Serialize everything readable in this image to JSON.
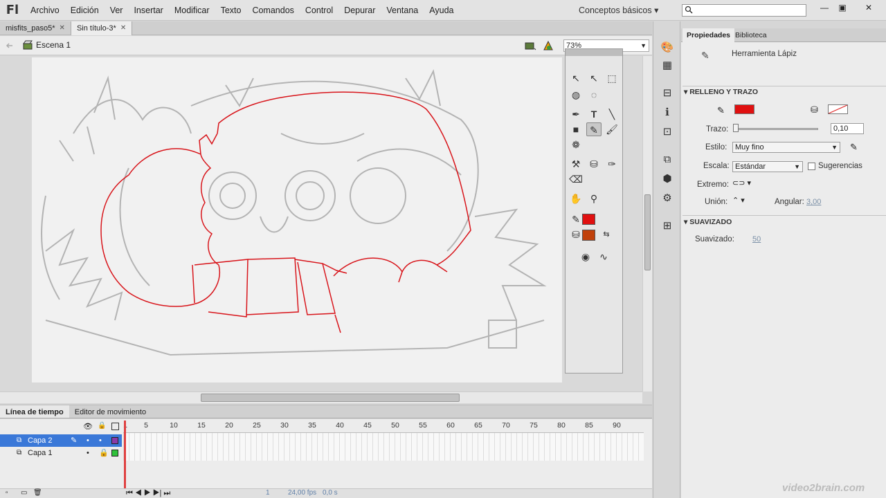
{
  "app": {
    "logo": "Fl",
    "workspace": "Conceptos básicos ▾"
  },
  "menu": [
    "Archivo",
    "Edición",
    "Ver",
    "Insertar",
    "Modificar",
    "Texto",
    "Comandos",
    "Control",
    "Depurar",
    "Ventana",
    "Ayuda"
  ],
  "window_buttons": [
    "—",
    "▣",
    "✕"
  ],
  "doc_tabs": [
    {
      "label": "misfits_paso5*",
      "close": "✕"
    },
    {
      "label": "Sin título-3*",
      "close": "✕"
    }
  ],
  "scene": {
    "label": "Escena 1",
    "zoom": "73%"
  },
  "timeline": {
    "tabs": [
      "Línea de tiempo",
      "Editor de movimiento"
    ],
    "ticks": [
      "1",
      "5",
      "10",
      "15",
      "20",
      "25",
      "30",
      "35",
      "40",
      "45",
      "50",
      "55",
      "60",
      "65",
      "70",
      "75",
      "80",
      "85",
      "90"
    ],
    "layers": [
      {
        "name": "Capa 2",
        "color": "#8a3aa8",
        "selected": true
      },
      {
        "name": "Capa 1",
        "color": "#2fc13a",
        "selected": false
      }
    ],
    "status": {
      "frame": "1",
      "fps": "24,00 fps",
      "time": "0,0 s"
    }
  },
  "properties": {
    "tabs": [
      "Propiedades",
      "Biblioteca"
    ],
    "tool_name": "Herramienta Lápiz",
    "fill_stroke": {
      "title": "RELLENO Y TRAZO",
      "stroke_color": "#e01010",
      "trazo_label": "Trazo:",
      "trazo_value": "0,10",
      "estilo_label": "Estilo:",
      "estilo_value": "Muy fino",
      "escala_label": "Escala:",
      "escala_value": "Estándar",
      "sugerencias_label": "Sugerencias",
      "extremo_label": "Extremo:",
      "union_label": "Unión:",
      "angular_label": "Angular:",
      "angular_value": "3,00"
    },
    "smoothing": {
      "title": "SUAVIZADO",
      "label": "Suavizado:",
      "value": "50"
    }
  },
  "tools": {
    "stroke_color": "#e01010",
    "fill_color": "#c0400a"
  },
  "watermark": "video2brain.com"
}
